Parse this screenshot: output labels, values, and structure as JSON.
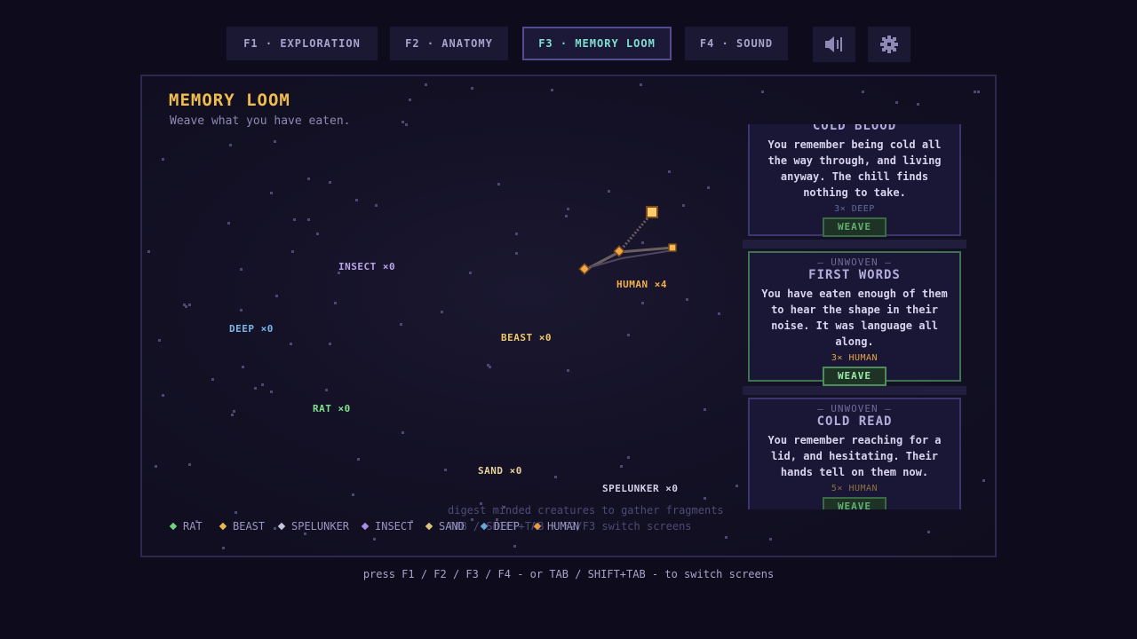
{
  "tabs": [
    {
      "label": "F1 · EXPLORATION",
      "active": false
    },
    {
      "label": "F2 · ANATOMY",
      "active": false
    },
    {
      "label": "F3 · MEMORY LOOM",
      "active": true
    },
    {
      "label": "F4 · SOUND",
      "active": false
    }
  ],
  "icons": {
    "sound": "speaker-icon",
    "settings": "gear-icon"
  },
  "loom": {
    "title": "MEMORY LOOM",
    "subtitle": "Weave what you have eaten."
  },
  "nodes": [
    {
      "label": "INSECT ×0",
      "color": "#b9a6ea"
    },
    {
      "label": "DEEP ×0",
      "color": "#79b8e6"
    },
    {
      "label": "BEAST ×0",
      "color": "#efc86a"
    },
    {
      "label": "RAT ×0",
      "color": "#7ee38c"
    },
    {
      "label": "SAND ×0",
      "color": "#e6d39a"
    },
    {
      "label": "SPELUNKER ×0",
      "color": "#d6d1ea"
    },
    {
      "label": "HUMAN ×4",
      "color": "#f0b04a"
    }
  ],
  "memories": [
    {
      "status": "",
      "title": "COLD BLOOD",
      "text": "You remember being cold all the way through, and living anyway. The chill finds nothing to take.",
      "cost": "3× DEEP",
      "cost_color": "#5a6d9a",
      "button": "WEAVE",
      "ready": false
    },
    {
      "status": "— UNWOVEN —",
      "title": "FIRST WORDS",
      "text": "You have eaten enough of them to hear the shape in their noise. It was language all along.",
      "cost": "3× HUMAN",
      "cost_color": "#e9a43e",
      "button": "WEAVE",
      "ready": true
    },
    {
      "status": "— UNWOVEN —",
      "title": "COLD READ",
      "text": "You remember reaching for a lid, and hesitating. Their hands tell on them now.",
      "cost": "5× HUMAN",
      "cost_color": "#8f7040",
      "button": "WEAVE",
      "ready": false
    }
  ],
  "legend": [
    {
      "label": "RAT",
      "color": "#6fd27e"
    },
    {
      "label": "BEAST",
      "color": "#e8b84e"
    },
    {
      "label": "SPELUNKER",
      "color": "#c9c4de"
    },
    {
      "label": "INSECT",
      "color": "#a98ce6"
    },
    {
      "label": "SAND",
      "color": "#dcc27a"
    },
    {
      "label": "DEEP",
      "color": "#6aa6dc"
    },
    {
      "label": "HUMAN",
      "color": "#e89a40"
    }
  ],
  "hints": {
    "line1": "digest minded creatures to gather fragments",
    "line2": "TAB / SHIFT+TAB · F2/F3 switch screens"
  },
  "footer": "press F1 / F2 / F3 / F4 - or TAB / SHIFT+TAB - to switch screens"
}
